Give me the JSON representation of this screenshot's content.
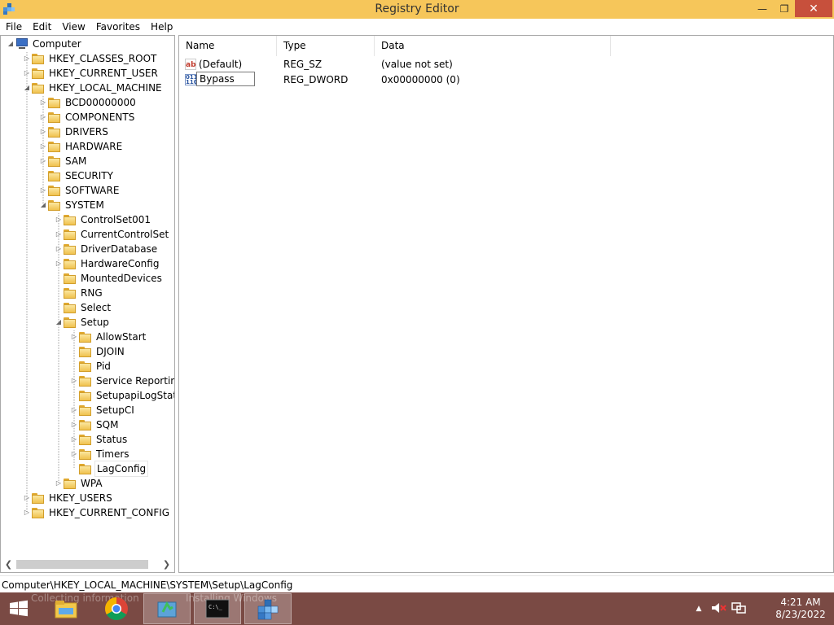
{
  "window": {
    "title": "Registry Editor",
    "minimize": "—",
    "restore": "❐",
    "close": "✕"
  },
  "menu": [
    "File",
    "Edit",
    "View",
    "Favorites",
    "Help"
  ],
  "tree": {
    "root": "Computer",
    "items": [
      "HKEY_CLASSES_ROOT",
      "HKEY_CURRENT_USER",
      "HKEY_LOCAL_MACHINE",
      "BCD00000000",
      "COMPONENTS",
      "DRIVERS",
      "HARDWARE",
      "SAM",
      "SECURITY",
      "SOFTWARE",
      "SYSTEM",
      "ControlSet001",
      "CurrentControlSet",
      "DriverDatabase",
      "HardwareConfig",
      "MountedDevices",
      "RNG",
      "Select",
      "Setup",
      "AllowStart",
      "DJOIN",
      "Pid",
      "Service Reporting",
      "SetupapiLogStatus",
      "SetupCI",
      "SQM",
      "Status",
      "Timers",
      "LagConfig",
      "WPA",
      "HKEY_USERS",
      "HKEY_CURRENT_CONFIG"
    ],
    "selected": "LagConfig"
  },
  "columns": {
    "name": "Name",
    "type": "Type",
    "data": "Data"
  },
  "values": [
    {
      "name": "(Default)",
      "type": "REG_SZ",
      "data": "(value not set)",
      "icon": "string-value-icon"
    },
    {
      "name": "Bypass",
      "type": "REG_DWORD",
      "data": "0x00000000 (0)",
      "icon": "binary-value-icon",
      "editing": true
    }
  ],
  "status": "Computer\\HKEY_LOCAL_MACHINE\\SYSTEM\\Setup\\LagConfig",
  "taskbar": {
    "labels": [
      "Collecting information",
      "Installing Windows"
    ],
    "clock": {
      "time": "4:21 AM",
      "date": "8/23/2022"
    }
  },
  "colors": {
    "titlebar": "#f6c65a",
    "close": "#c7503c",
    "taskbar": "#7a4a44"
  }
}
